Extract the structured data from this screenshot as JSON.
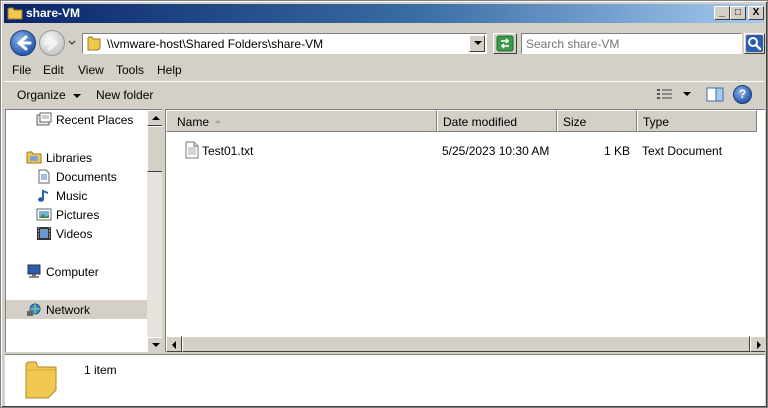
{
  "window": {
    "title": "share-VM"
  },
  "titlebar": {
    "minimize": "_",
    "maximize": "□",
    "close": "X"
  },
  "address": {
    "path": "\\\\vmware-host\\Shared Folders\\share-VM",
    "search_placeholder": "Search share-VM"
  },
  "menubar": {
    "items": [
      "File",
      "Edit",
      "View",
      "Tools",
      "Help"
    ]
  },
  "toolbar": {
    "organize_label": "Organize",
    "new_folder_label": "New folder",
    "help_label": "?"
  },
  "navpane": {
    "items": [
      {
        "label": "Recent Places",
        "icon": "recent-places-icon"
      },
      {
        "label": "Libraries",
        "icon": "libraries-icon"
      },
      {
        "label": "Documents",
        "icon": "documents-icon"
      },
      {
        "label": "Music",
        "icon": "music-icon"
      },
      {
        "label": "Pictures",
        "icon": "pictures-icon"
      },
      {
        "label": "Videos",
        "icon": "videos-icon"
      },
      {
        "label": "Computer",
        "icon": "computer-icon"
      },
      {
        "label": "Network",
        "icon": "network-icon"
      }
    ],
    "selected": "Network"
  },
  "filelist": {
    "columns": [
      "Name",
      "Date modified",
      "Size",
      "Type"
    ],
    "sort_column": "Name",
    "rows": [
      {
        "name": "Test01.txt",
        "date_modified": "5/25/2023 10:30 AM",
        "size": "1 KB",
        "type": "Text Document"
      }
    ]
  },
  "details": {
    "item_count": "1 item"
  },
  "colors": {
    "title_gradient_start": "#0a246a",
    "title_gradient_end": "#a6caf0",
    "face": "#d4d0c8"
  }
}
